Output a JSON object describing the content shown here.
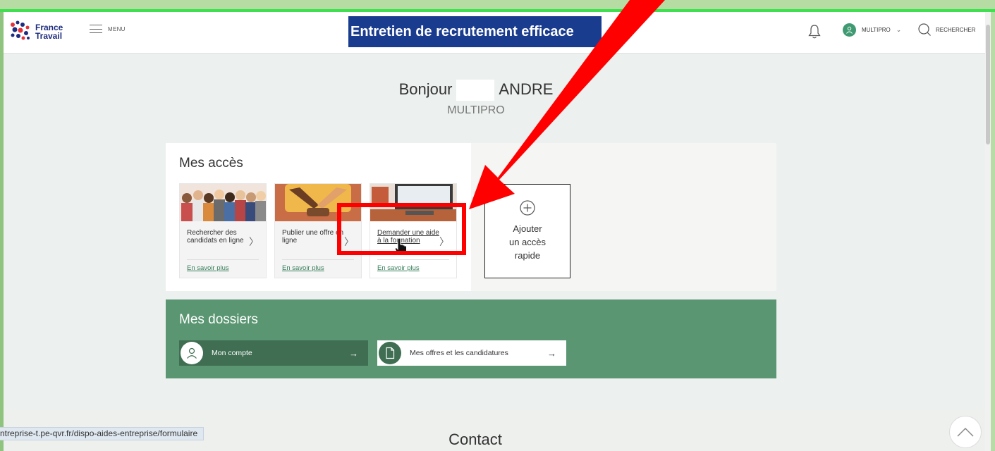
{
  "header": {
    "logo_line1": "France",
    "logo_line2": "Travail",
    "menu_label": "MENU",
    "banner": "Entretien de recrutement efficace",
    "account_name": "MULTIPRO",
    "search_label": "RECHERCHER"
  },
  "greeting": {
    "hello": "Bonjour",
    "name": "ANDRE",
    "company": "MULTIPRO"
  },
  "acces": {
    "title": "Mes accès",
    "cards": [
      {
        "title": "Rechercher des candidats en ligne",
        "more": "En savoir plus"
      },
      {
        "title": "Publier une offre en ligne",
        "more": "En savoir plus"
      },
      {
        "title": "Demander une aide à la formation",
        "more": "En savoir plus"
      }
    ],
    "add_line1": "Ajouter",
    "add_line2": "un accès",
    "add_line3": "rapide"
  },
  "dossiers": {
    "title": "Mes dossiers",
    "account_btn": "Mon compte",
    "offers_btn": "Mes offres et les candidatures"
  },
  "footer": {
    "contact": "Contact"
  },
  "status_url": "ntreprise-t.pe-qvr.fr/dispo-aides-entreprise/formulaire",
  "colors": {
    "accent_green": "#5a9672",
    "dark_green": "#3f6e52",
    "banner_blue": "#1a3c8e",
    "annotation_red": "#ff0000"
  },
  "icons": [
    "hamburger-icon",
    "bell-icon",
    "user-icon",
    "search-icon",
    "chevron-right-icon",
    "plus-circle-icon",
    "arrow-right-icon",
    "document-icon",
    "chevron-up-icon",
    "hand-cursor-icon"
  ]
}
